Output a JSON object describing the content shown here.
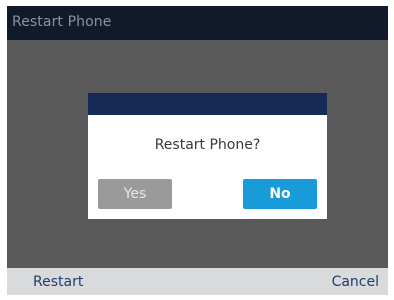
{
  "title_bar": {
    "title": "Restart Phone"
  },
  "dialog": {
    "message": "Restart Phone?",
    "yes_label": "Yes",
    "no_label": "No"
  },
  "softkeys": {
    "left_label": "Restart",
    "right_label": "Cancel"
  },
  "colors": {
    "title_bar_bg": "#101a2a",
    "screen_bg": "#595959",
    "dialog_header": "#152a55",
    "no_button": "#1a9bd9",
    "yes_button": "#9a9a9a",
    "softkey_bar": "#d9dadc",
    "softkey_text": "#1f3d6e"
  }
}
